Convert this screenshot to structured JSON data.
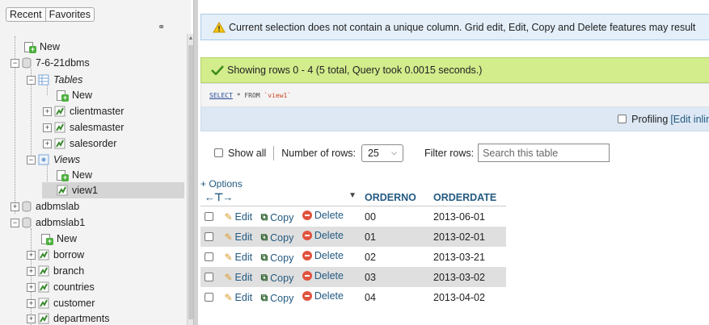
{
  "nav": {
    "tabs": [
      "Recent",
      "Favorites"
    ],
    "tree": [
      {
        "label": "New",
        "type": "new"
      },
      {
        "label": "7-6-21dbms",
        "type": "db"
      },
      {
        "label": "Tables",
        "type": "group"
      },
      {
        "label": "New",
        "type": "new"
      },
      {
        "label": "clientmaster",
        "type": "table"
      },
      {
        "label": "salesmaster",
        "type": "table"
      },
      {
        "label": "salesorder",
        "type": "table"
      },
      {
        "label": "Views",
        "type": "group"
      },
      {
        "label": "New",
        "type": "new"
      },
      {
        "label": "view1",
        "type": "table"
      },
      {
        "label": "adbmslab",
        "type": "db"
      },
      {
        "label": "adbmslab1",
        "type": "db"
      },
      {
        "label": "New",
        "type": "new"
      },
      {
        "label": "borrow",
        "type": "table"
      },
      {
        "label": "branch",
        "type": "table"
      },
      {
        "label": "countries",
        "type": "table"
      },
      {
        "label": "customer",
        "type": "table"
      },
      {
        "label": "departments",
        "type": "table"
      }
    ]
  },
  "main": {
    "warning": "Current selection does not contain a unique column. Grid edit, Edit, Copy and Delete features may result",
    "success": "Showing rows 0 - 4 (5 total, Query took 0.0015 seconds.)",
    "sql": {
      "select": "SELECT",
      "rest": " * FROM ",
      "table": "`view1`"
    },
    "profiling": {
      "label": "Profiling",
      "link": "[Edit inline"
    },
    "controls": {
      "show_all": "Show all",
      "rows_label": "Number of rows:",
      "rows_value": "25",
      "filter_label": "Filter rows:",
      "filter_placeholder": "Search this table"
    },
    "options": "+ Options",
    "table": {
      "columns": [
        "ORDERNO",
        "ORDERDATE"
      ],
      "actions": {
        "edit": "Edit",
        "copy": "Copy",
        "delete": "Delete"
      },
      "rows": [
        [
          "00",
          "2013-06-01"
        ],
        [
          "01",
          "2013-02-01"
        ],
        [
          "02",
          "2013-03-21"
        ],
        [
          "03",
          "2013-03-02"
        ],
        [
          "04",
          "2013-04-02"
        ]
      ]
    }
  }
}
